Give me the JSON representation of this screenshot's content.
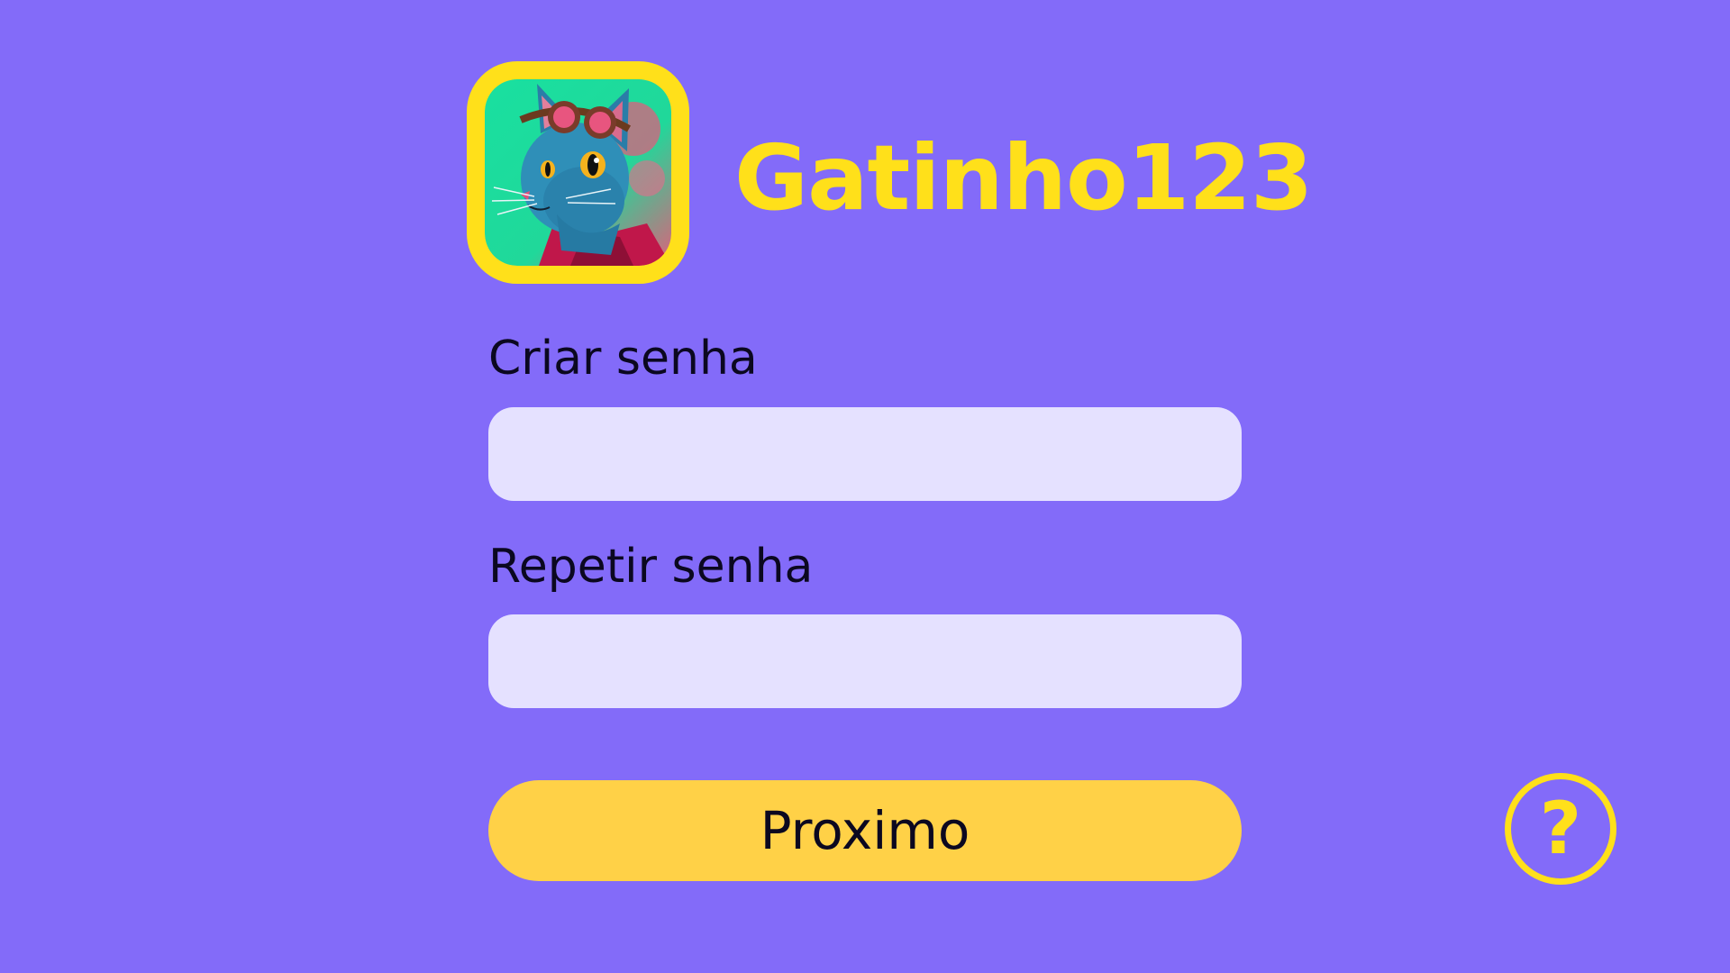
{
  "profile": {
    "username": "Gatinho123",
    "avatar_icon": "cat-with-goggles-avatar-icon"
  },
  "form": {
    "create_password_label": "Criar senha",
    "create_password_value": "",
    "repeat_password_label": "Repetir senha",
    "repeat_password_value": "",
    "next_button_label": "Proximo"
  },
  "help": {
    "icon": "question-mark-icon",
    "glyph": "?"
  },
  "colors": {
    "background": "#836BF9",
    "accent_yellow": "#FFE01A",
    "button_yellow": "#FFD147",
    "input_fill": "#E5E1FF",
    "text_dark": "#0B0820"
  }
}
